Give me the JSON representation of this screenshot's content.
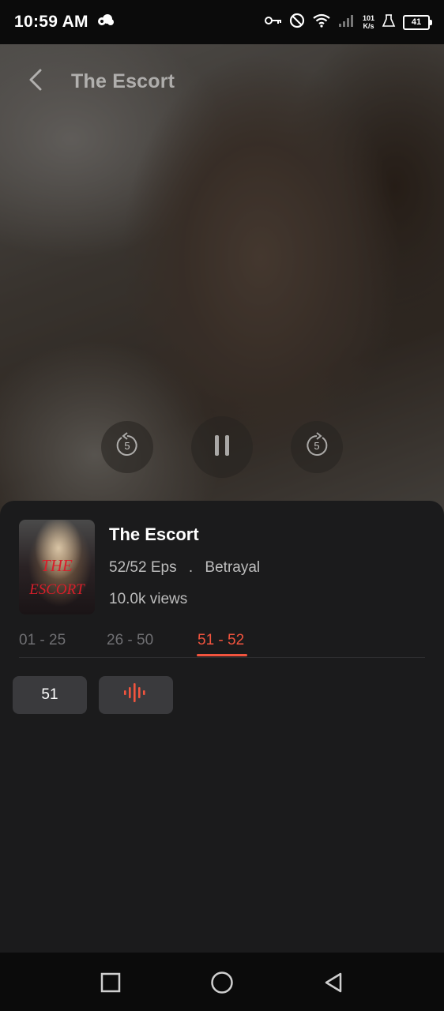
{
  "status_bar": {
    "time": "10:59 AM",
    "net_speed_value": "101",
    "net_speed_unit": "K/s",
    "battery": "41",
    "icons": [
      "cloud-icon",
      "key-icon",
      "block-icon",
      "wifi-icon",
      "signal-icon",
      "flask-icon",
      "battery-icon"
    ]
  },
  "player": {
    "title": "The Escort",
    "back_icon": "chevron-left-icon",
    "rewind_seconds": "5",
    "forward_seconds": "5",
    "state": "playing"
  },
  "details": {
    "poster_text_line1": "THE",
    "poster_text_line2": "ESCORT",
    "title": "The Escort",
    "episodes": "52/52 Eps",
    "separator": ".",
    "genre": "Betrayal",
    "views": "10.0k views"
  },
  "episode_tabs": [
    {
      "label": "01 - 25",
      "active": false
    },
    {
      "label": "26 - 50",
      "active": false
    },
    {
      "label": "51 - 52",
      "active": true
    }
  ],
  "episodes": [
    {
      "label": "51",
      "playing": false
    },
    {
      "label": "",
      "playing": true
    }
  ],
  "colors": {
    "accent": "#f2543e",
    "sheet_bg": "#1b1b1c",
    "episode_button_bg": "#3a3a3d"
  },
  "nav": [
    "recents-square-icon",
    "home-circle-icon",
    "back-triangle-icon"
  ]
}
